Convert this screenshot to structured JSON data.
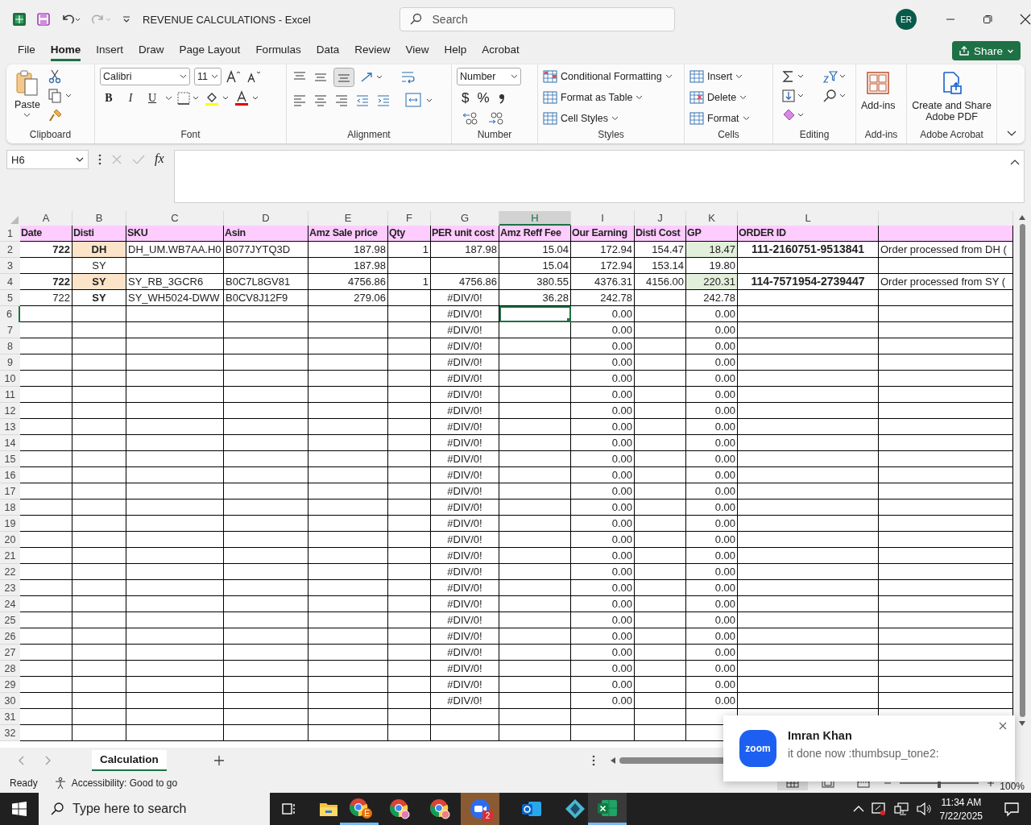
{
  "title_bar": {
    "title": "REVENUE CALCULATIONS  -  Excel",
    "search_placeholder": "Search",
    "avatar": "ER"
  },
  "menu_tabs": [
    {
      "label": "File",
      "selected": false
    },
    {
      "label": "Home",
      "selected": true
    },
    {
      "label": "Insert",
      "selected": false
    },
    {
      "label": "Draw",
      "selected": false
    },
    {
      "label": "Page Layout",
      "selected": false
    },
    {
      "label": "Formulas",
      "selected": false
    },
    {
      "label": "Data",
      "selected": false
    },
    {
      "label": "Review",
      "selected": false
    },
    {
      "label": "View",
      "selected": false
    },
    {
      "label": "Help",
      "selected": false
    },
    {
      "label": "Acrobat",
      "selected": false
    }
  ],
  "share_button": "Share",
  "ribbon": [
    {
      "kind": "clipboard",
      "label": "Clipboard",
      "button": "Paste"
    },
    {
      "kind": "font",
      "label": "Font",
      "font": "Calibri",
      "size": "11",
      "styles": [
        "B",
        "I",
        "U"
      ]
    },
    {
      "kind": "alignment",
      "label": "Alignment"
    },
    {
      "kind": "number",
      "label": "Number",
      "format": "Number",
      "symbols": [
        "$",
        "%"
      ]
    },
    {
      "kind": "styles",
      "label": "Styles",
      "items": [
        "Conditional Formatting",
        "Format as Table",
        "Cell Styles"
      ]
    },
    {
      "kind": "cells",
      "label": "Cells",
      "items": [
        "Insert",
        "Delete",
        "Format"
      ]
    },
    {
      "kind": "editing",
      "label": "Editing"
    },
    {
      "kind": "addins",
      "label": "Add-ins",
      "button": "Add-ins"
    },
    {
      "kind": "acrobat",
      "label": "Adobe Acrobat",
      "button": "Create and Share Adobe PDF"
    }
  ],
  "formula_bar": {
    "name_box": "H6",
    "function_label": "fx"
  },
  "grid": {
    "columns": [
      "A",
      "B",
      "C",
      "D",
      "E",
      "F",
      "G",
      "H",
      "I",
      "J",
      "K",
      "L"
    ],
    "rows": [
      {
        "number": "1",
        "kind": "header",
        "cells": [
          {
            "text": "Date"
          },
          {
            "text": "Disti"
          },
          {
            "text": "SKU"
          },
          {
            "text": "Asin"
          },
          {
            "text": "Amz Sale price"
          },
          {
            "text": "Qty"
          },
          {
            "text": "PER unit cost"
          },
          {
            "text": "Amz Reff Fee"
          },
          {
            "text": "Our Earning"
          },
          {
            "text": "Disti Cost"
          },
          {
            "text": "GP"
          },
          {
            "text": "ORDER ID"
          }
        ]
      },
      {
        "number": "2",
        "cells": [
          {
            "text": "722",
            "bold": true
          },
          {
            "text": "DH",
            "bold": true,
            "color": "#fce4c8"
          },
          {
            "text": "DH_UM.WB7AA.H0"
          },
          {
            "text": "B077JYTQ3D"
          },
          {
            "text": "187.98"
          },
          {
            "text": "1"
          },
          {
            "text": "187.98"
          },
          {
            "text": "15.04"
          },
          {
            "text": "172.94"
          },
          {
            "text": "154.47"
          },
          {
            "text": "18.47",
            "color": "#e2efda"
          },
          {
            "text": "111-2160751-9513841",
            "kind": "order"
          }
        ],
        "note": "Order processed from DH ("
      },
      {
        "number": "3",
        "cells": [
          null,
          {
            "text": "SY"
          },
          null,
          null,
          {
            "text": "187.98"
          },
          null,
          null,
          {
            "text": "15.04"
          },
          {
            "text": "172.94"
          },
          {
            "text": "153.14"
          },
          {
            "text": "19.80"
          },
          null
        ]
      },
      {
        "number": "4",
        "cells": [
          {
            "text": "722",
            "bold": true
          },
          {
            "text": "SY",
            "bold": true,
            "color": "#fce4c8"
          },
          {
            "text": "SY_RB_3GCR6"
          },
          {
            "text": "B0C7L8GV81"
          },
          {
            "text": "4756.86"
          },
          {
            "text": "1"
          },
          {
            "text": "4756.86"
          },
          {
            "text": "380.55"
          },
          {
            "text": "4376.31"
          },
          {
            "text": "4156.00"
          },
          {
            "text": "220.31",
            "color": "#e2efda"
          },
          {
            "text": "114-7571954-2739447",
            "kind": "order"
          }
        ],
        "note": "Order processed from SY ("
      },
      {
        "number": "5",
        "cells": [
          {
            "text": "722"
          },
          {
            "text": "SY",
            "bold": true
          },
          {
            "text": "SY_WH5024-DWW"
          },
          {
            "text": "B0CV8J12F9"
          },
          {
            "text": "279.06"
          },
          null,
          {
            "text": "#DIV/0!",
            "kind": "error"
          },
          {
            "text": "36.28"
          },
          {
            "text": "242.78"
          },
          null,
          {
            "text": "242.78"
          },
          null
        ]
      },
      {
        "number": "6",
        "cells": [
          null,
          null,
          null,
          null,
          null,
          null,
          {
            "text": "#DIV/0!",
            "kind": "error"
          },
          {
            "selected": true
          },
          {
            "text": "0.00"
          },
          null,
          {
            "text": "0.00"
          },
          null
        ]
      },
      {
        "number": "7",
        "cells": [
          null,
          null,
          null,
          null,
          null,
          null,
          {
            "text": "#DIV/0!",
            "kind": "error"
          },
          null,
          {
            "text": "0.00"
          },
          null,
          {
            "text": "0.00"
          },
          null
        ]
      },
      {
        "number": "8",
        "cells": [
          null,
          null,
          null,
          null,
          null,
          null,
          {
            "text": "#DIV/0!",
            "kind": "error"
          },
          null,
          {
            "text": "0.00"
          },
          null,
          {
            "text": "0.00"
          },
          null
        ]
      },
      {
        "number": "9",
        "cells": [
          null,
          null,
          null,
          null,
          null,
          null,
          {
            "text": "#DIV/0!",
            "kind": "error"
          },
          null,
          {
            "text": "0.00"
          },
          null,
          {
            "text": "0.00"
          },
          null
        ]
      },
      {
        "number": "10",
        "cells": [
          null,
          null,
          null,
          null,
          null,
          null,
          {
            "text": "#DIV/0!",
            "kind": "error"
          },
          null,
          {
            "text": "0.00"
          },
          null,
          {
            "text": "0.00"
          },
          null
        ]
      },
      {
        "number": "11",
        "cells": [
          null,
          null,
          null,
          null,
          null,
          null,
          {
            "text": "#DIV/0!",
            "kind": "error"
          },
          null,
          {
            "text": "0.00"
          },
          null,
          {
            "text": "0.00"
          },
          null
        ]
      },
      {
        "number": "12",
        "cells": [
          null,
          null,
          null,
          null,
          null,
          null,
          {
            "text": "#DIV/0!",
            "kind": "error"
          },
          null,
          {
            "text": "0.00"
          },
          null,
          {
            "text": "0.00"
          },
          null
        ]
      },
      {
        "number": "13",
        "cells": [
          null,
          null,
          null,
          null,
          null,
          null,
          {
            "text": "#DIV/0!",
            "kind": "error"
          },
          null,
          {
            "text": "0.00"
          },
          null,
          {
            "text": "0.00"
          },
          null
        ]
      },
      {
        "number": "14",
        "cells": [
          null,
          null,
          null,
          null,
          null,
          null,
          {
            "text": "#DIV/0!",
            "kind": "error"
          },
          null,
          {
            "text": "0.00"
          },
          null,
          {
            "text": "0.00"
          },
          null
        ]
      },
      {
        "number": "15",
        "cells": [
          null,
          null,
          null,
          null,
          null,
          null,
          {
            "text": "#DIV/0!",
            "kind": "error"
          },
          null,
          {
            "text": "0.00"
          },
          null,
          {
            "text": "0.00"
          },
          null
        ]
      },
      {
        "number": "16",
        "cells": [
          null,
          null,
          null,
          null,
          null,
          null,
          {
            "text": "#DIV/0!",
            "kind": "error"
          },
          null,
          {
            "text": "0.00"
          },
          null,
          {
            "text": "0.00"
          },
          null
        ]
      },
      {
        "number": "17",
        "cells": [
          null,
          null,
          null,
          null,
          null,
          null,
          {
            "text": "#DIV/0!",
            "kind": "error"
          },
          null,
          {
            "text": "0.00"
          },
          null,
          {
            "text": "0.00"
          },
          null
        ]
      },
      {
        "number": "18",
        "cells": [
          null,
          null,
          null,
          null,
          null,
          null,
          {
            "text": "#DIV/0!",
            "kind": "error"
          },
          null,
          {
            "text": "0.00"
          },
          null,
          {
            "text": "0.00"
          },
          null
        ]
      },
      {
        "number": "19",
        "cells": [
          null,
          null,
          null,
          null,
          null,
          null,
          {
            "text": "#DIV/0!",
            "kind": "error"
          },
          null,
          {
            "text": "0.00"
          },
          null,
          {
            "text": "0.00"
          },
          null
        ]
      },
      {
        "number": "20",
        "cells": [
          null,
          null,
          null,
          null,
          null,
          null,
          {
            "text": "#DIV/0!",
            "kind": "error"
          },
          null,
          {
            "text": "0.00"
          },
          null,
          {
            "text": "0.00"
          },
          null
        ]
      },
      {
        "number": "21",
        "cells": [
          null,
          null,
          null,
          null,
          null,
          null,
          {
            "text": "#DIV/0!",
            "kind": "error"
          },
          null,
          {
            "text": "0.00"
          },
          null,
          {
            "text": "0.00"
          },
          null
        ]
      },
      {
        "number": "22",
        "cells": [
          null,
          null,
          null,
          null,
          null,
          null,
          {
            "text": "#DIV/0!",
            "kind": "error"
          },
          null,
          {
            "text": "0.00"
          },
          null,
          {
            "text": "0.00"
          },
          null
        ]
      },
      {
        "number": "23",
        "cells": [
          null,
          null,
          null,
          null,
          null,
          null,
          {
            "text": "#DIV/0!",
            "kind": "error"
          },
          null,
          {
            "text": "0.00"
          },
          null,
          {
            "text": "0.00"
          },
          null
        ]
      },
      {
        "number": "24",
        "cells": [
          null,
          null,
          null,
          null,
          null,
          null,
          {
            "text": "#DIV/0!",
            "kind": "error"
          },
          null,
          {
            "text": "0.00"
          },
          null,
          {
            "text": "0.00"
          },
          null
        ]
      },
      {
        "number": "25",
        "cells": [
          null,
          null,
          null,
          null,
          null,
          null,
          {
            "text": "#DIV/0!",
            "kind": "error"
          },
          null,
          {
            "text": "0.00"
          },
          null,
          {
            "text": "0.00"
          },
          null
        ]
      },
      {
        "number": "26",
        "cells": [
          null,
          null,
          null,
          null,
          null,
          null,
          {
            "text": "#DIV/0!",
            "kind": "error"
          },
          null,
          {
            "text": "0.00"
          },
          null,
          {
            "text": "0.00"
          },
          null
        ]
      },
      {
        "number": "27",
        "cells": [
          null,
          null,
          null,
          null,
          null,
          null,
          {
            "text": "#DIV/0!",
            "kind": "error"
          },
          null,
          {
            "text": "0.00"
          },
          null,
          {
            "text": "0.00"
          },
          null
        ]
      },
      {
        "number": "28",
        "cells": [
          null,
          null,
          null,
          null,
          null,
          null,
          {
            "text": "#DIV/0!",
            "kind": "error"
          },
          null,
          {
            "text": "0.00"
          },
          null,
          {
            "text": "0.00"
          },
          null
        ]
      },
      {
        "number": "29",
        "cells": [
          null,
          null,
          null,
          null,
          null,
          null,
          {
            "text": "#DIV/0!",
            "kind": "error"
          },
          null,
          {
            "text": "0.00"
          },
          null,
          {
            "text": "0.00"
          },
          null
        ]
      },
      {
        "number": "30",
        "cells": [
          null,
          null,
          null,
          null,
          null,
          null,
          {
            "text": "#DIV/0!",
            "kind": "error"
          },
          null,
          {
            "text": "0.00"
          },
          null,
          {
            "text": "0.00"
          },
          null
        ]
      },
      {
        "number": "31"
      },
      {
        "number": "32"
      }
    ]
  },
  "sheet_tabs": [
    {
      "label": "Calculation",
      "selected": true
    }
  ],
  "status_bar": {
    "status": "Ready",
    "accessibility": "Accessibility: Good to go",
    "zoom_slider": {
      "level": 0.5
    },
    "zoom": "100%"
  },
  "notification": {
    "logo": "zoom",
    "sender": "Imran Khan",
    "message": "it done now :thumbsup_tone2:"
  },
  "taskbar": {
    "search_placeholder": "Type here to search",
    "browser_badge": "E",
    "chat_badge": "2",
    "time": "11:34 AM",
    "date": "7/22/2025"
  }
}
